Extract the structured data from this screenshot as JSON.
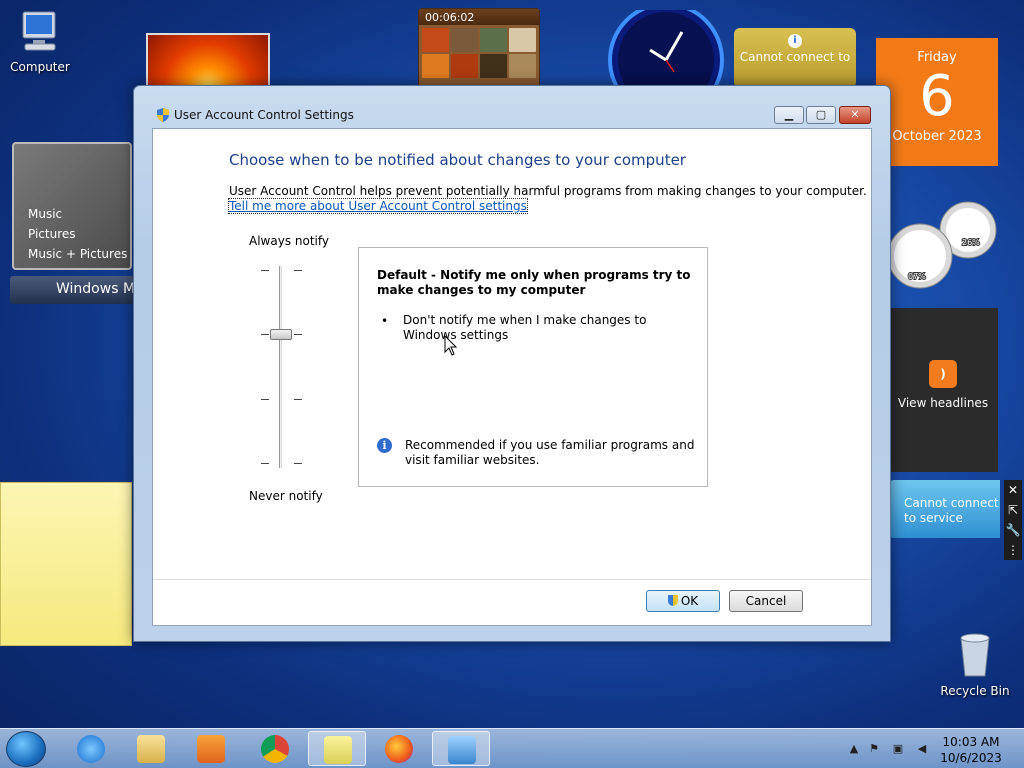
{
  "desktop": {
    "computer_label": "Computer",
    "recycle_label": "Recycle Bin"
  },
  "gadgets": {
    "puzzle_timer": "00:06:02",
    "weather_top": "Cannot connect to service",
    "calendar": {
      "day": "Friday",
      "date": "6",
      "month_year": "October 2023"
    },
    "media": {
      "items": [
        "Music",
        "Pictures",
        "Music + Pictures"
      ],
      "bar_label": "Windows Media Center"
    },
    "meters": {
      "cpu": "07%",
      "memory": "26%"
    },
    "feeds_label": "View headlines",
    "weather_side": "Cannot connect to service"
  },
  "window": {
    "title": "User Account Control Settings",
    "heading": "Choose when to be notified about changes to your computer",
    "description": "User Account Control helps prevent potentially harmful programs from making changes to your computer.",
    "link": "Tell me more about User Account Control settings",
    "always_label": "Always notify",
    "never_label": "Never notify",
    "slider_level": 2,
    "slider_levels": 4,
    "box_title": "Default - Notify me only when programs try to make changes to my computer",
    "bullet": "Don't notify me when I make changes to Windows settings",
    "recommend": "Recommended if you use familiar programs and visit familiar websites.",
    "ok_label": "OK",
    "cancel_label": "Cancel"
  },
  "taskbar": {
    "time": "10:03 AM",
    "date": "10/6/2023",
    "apps": [
      "internet-explorer",
      "file-explorer",
      "media-player",
      "chrome",
      "sticky-notes",
      "firefox",
      "control-panel"
    ]
  },
  "colors": {
    "accent": "#1e3f8a",
    "link": "#0a57b8",
    "calendar": "#f37a17"
  }
}
